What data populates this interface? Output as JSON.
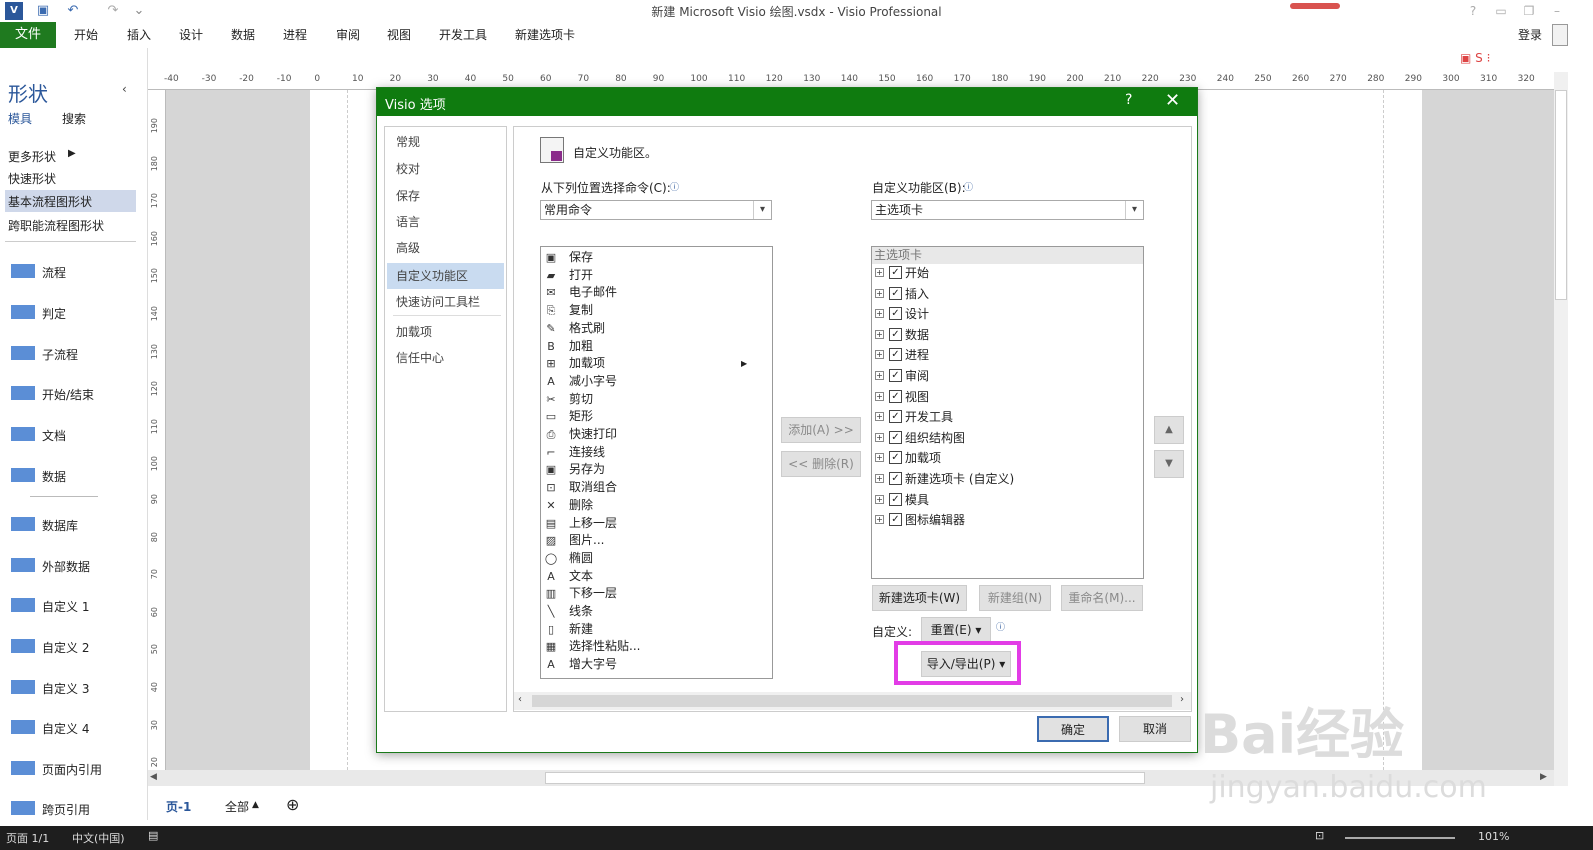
{
  "window": {
    "title": "新建 Microsoft Visio 绘图.vsdx - Visio Professional",
    "login": "登录",
    "help": "?"
  },
  "ribbon": {
    "file": "文件",
    "tabs": [
      "开始",
      "插入",
      "设计",
      "数据",
      "进程",
      "审阅",
      "视图",
      "开发工具",
      "新建选项卡"
    ]
  },
  "shapes_panel": {
    "title": "形状",
    "tab_stencils": "模具",
    "tab_search": "搜索",
    "more_shapes": "更多形状",
    "quick_shapes": "快速形状",
    "selected_stencil": "基本流程图形状",
    "other_stencil": "跨职能流程图形状",
    "shapes": [
      "流程",
      "判定",
      "子流程",
      "开始/结束",
      "文档",
      "数据",
      "数据库",
      "外部数据",
      "自定义 1",
      "自定义 2",
      "自定义 3",
      "自定义 4",
      "页面内引用",
      "跨页引用"
    ]
  },
  "ruler": {
    "h_ticks": [
      "-40",
      "-30",
      "-20",
      "-10",
      "0",
      "10",
      "20",
      "30",
      "40",
      "50",
      "60",
      "70",
      "80",
      "90",
      "100",
      "110",
      "120",
      "130",
      "140",
      "150",
      "160",
      "170",
      "180",
      "190",
      "200",
      "210",
      "220",
      "230",
      "240",
      "250",
      "260",
      "270",
      "280",
      "290",
      "300",
      "310",
      "320"
    ],
    "v_ticks": [
      "190",
      "180",
      "170",
      "160",
      "150",
      "140",
      "130",
      "120",
      "110",
      "100",
      "90",
      "80",
      "70",
      "60",
      "50",
      "40",
      "30",
      "20"
    ]
  },
  "page_tabs": {
    "current": "页-1",
    "all": "全部",
    "add": "⊕"
  },
  "status": {
    "page": "页面 1/1",
    "lang": "中文(中国)",
    "zoom": "101%"
  },
  "dialog": {
    "title": "Visio 选项",
    "help": "?",
    "close": "✕",
    "nav": [
      "常规",
      "校对",
      "保存",
      "语言",
      "高级",
      "自定义功能区",
      "快速访问工具栏",
      "加载项",
      "信任中心"
    ],
    "nav_selected_index": 5,
    "heading": "自定义功能区。",
    "choose_from_label": "从下列位置选择命令(C):",
    "choose_from_value": "常用命令",
    "customize_label": "自定义功能区(B):",
    "customize_value": "主选项卡",
    "commands": [
      {
        "icon": "save-icon",
        "label": "保存"
      },
      {
        "icon": "open-folder-icon",
        "label": "打开"
      },
      {
        "icon": "email-icon",
        "label": "电子邮件"
      },
      {
        "icon": "copy-icon",
        "label": "复制"
      },
      {
        "icon": "format-painter-icon",
        "label": "格式刷"
      },
      {
        "icon": "bold-icon",
        "label": "加粗"
      },
      {
        "icon": "addins-icon",
        "label": "加载项",
        "submenu": true
      },
      {
        "icon": "decrease-font-icon",
        "label": "减小字号"
      },
      {
        "icon": "cut-icon",
        "label": "剪切"
      },
      {
        "icon": "rectangle-icon",
        "label": "矩形"
      },
      {
        "icon": "quick-print-icon",
        "label": "快速打印"
      },
      {
        "icon": "connector-icon",
        "label": "连接线"
      },
      {
        "icon": "save-as-icon",
        "label": "另存为"
      },
      {
        "icon": "ungroup-icon",
        "label": "取消组合"
      },
      {
        "icon": "delete-icon",
        "label": "删除"
      },
      {
        "icon": "bring-forward-icon",
        "label": "上移一层"
      },
      {
        "icon": "picture-icon",
        "label": "图片..."
      },
      {
        "icon": "ellipse-icon",
        "label": "椭圆"
      },
      {
        "icon": "text-icon",
        "label": "文本"
      },
      {
        "icon": "send-backward-icon",
        "label": "下移一层"
      },
      {
        "icon": "line-icon",
        "label": "线条"
      },
      {
        "icon": "new-icon",
        "label": "新建"
      },
      {
        "icon": "paste-special-icon",
        "label": "选择性粘贴..."
      },
      {
        "icon": "increase-font-icon",
        "label": "增大字号"
      }
    ],
    "tabs_header": "主选项卡",
    "tabs_tree": [
      "开始",
      "插入",
      "设计",
      "数据",
      "进程",
      "审阅",
      "视图",
      "开发工具",
      "组织结构图",
      "加载项",
      "新建选项卡 (自定义)",
      "模具",
      "图标编辑器"
    ],
    "add_button": "添加(A) >>",
    "remove_button": "<< 删除(R)",
    "new_tab_button": "新建选项卡(W)",
    "new_group_button": "新建组(N)",
    "rename_button": "重命名(M)...",
    "customize_label2": "自定义:",
    "reset_button": "重置(E) ▾",
    "import_export_button": "导入/导出(P) ▾",
    "ok": "确定",
    "cancel": "取消"
  },
  "watermark": {
    "brand": "Bai经验",
    "url": "jingyan.baidu.com"
  },
  "colors": {
    "accent_green": "#0f7b0f",
    "highlight": "#e23ce6",
    "shape_blue": "#5b8ed6"
  }
}
